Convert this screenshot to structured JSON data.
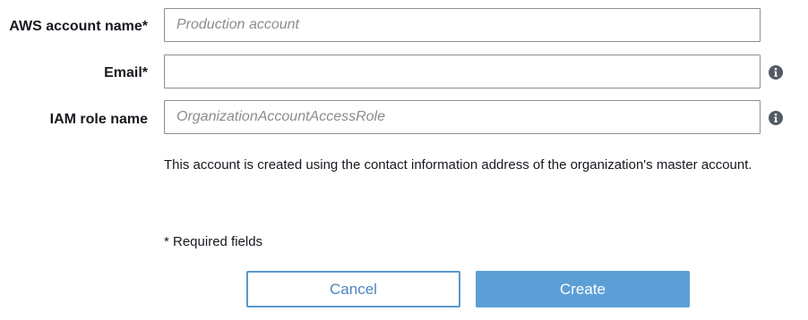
{
  "form": {
    "account_name": {
      "label": "AWS account name*",
      "value": "",
      "placeholder": "Production account"
    },
    "email": {
      "label": "Email*",
      "value": "",
      "placeholder": ""
    },
    "iam_role": {
      "label": "IAM role name",
      "value": "",
      "placeholder": "OrganizationAccountAccessRole"
    },
    "help_text": "This account is created using the contact information address of the organization's master account.",
    "required_note": "* Required fields"
  },
  "buttons": {
    "cancel_label": "Cancel",
    "create_label": "Create"
  },
  "icons": {
    "email_info": "info-icon",
    "iam_role_info": "info-icon"
  },
  "colors": {
    "primary": "#5c9fd6",
    "secondary_border": "#5a96cd",
    "input_border": "#8f8f8f",
    "text": "#16191f",
    "placeholder": "#8c8c8c"
  }
}
